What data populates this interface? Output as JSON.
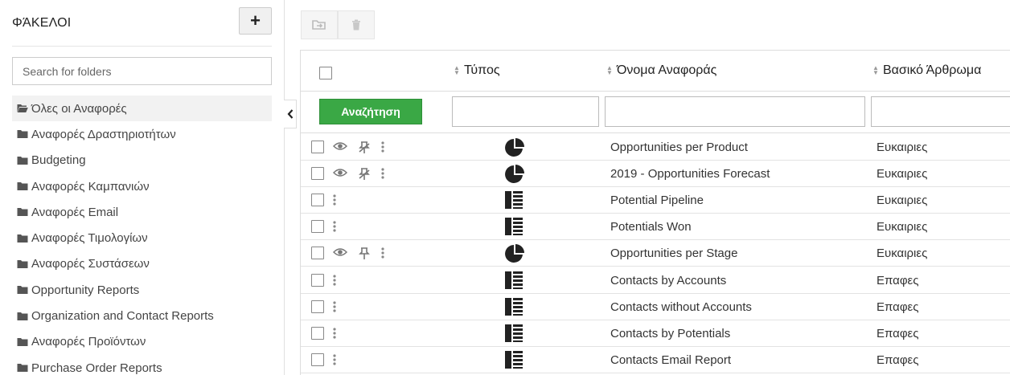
{
  "sidebar": {
    "title": "ΦΆΚΕΛΟΙ",
    "add_label": "+",
    "search_placeholder": "Search for folders",
    "folders": [
      {
        "label": "Όλες οι Αναφορές",
        "active": true
      },
      {
        "label": "Αναφορές Δραστηριοτήτων"
      },
      {
        "label": "Budgeting"
      },
      {
        "label": "Αναφορές Καμπανιών"
      },
      {
        "label": "Αναφορές Email"
      },
      {
        "label": "Αναφορές Τιμολογίων"
      },
      {
        "label": "Αναφορές Συστάσεων"
      },
      {
        "label": "Opportunity Reports"
      },
      {
        "label": "Organization and Contact Reports"
      },
      {
        "label": "Αναφορές Προϊόντων"
      },
      {
        "label": "Purchase Order Reports"
      }
    ]
  },
  "table": {
    "columns": {
      "type": "Τύπος",
      "name": "Όνομα Αναφοράς",
      "module": "Βασικό Άρθρωμα"
    },
    "search_button": "Αναζήτηση",
    "rows": [
      {
        "icon": "pie-chart-icon",
        "name": "Opportunities per Product",
        "module": "Ευκαιριες",
        "actions": [
          "eye-icon",
          "unpin-icon",
          "more-icon"
        ]
      },
      {
        "icon": "pie-chart-icon",
        "name": "2019 - Opportunities Forecast",
        "module": "Ευκαιριες",
        "actions": [
          "eye-icon",
          "unpin-icon",
          "more-icon"
        ]
      },
      {
        "icon": "table-report-icon",
        "name": "Potential Pipeline",
        "module": "Ευκαιριες",
        "actions": [
          "more-icon"
        ]
      },
      {
        "icon": "table-report-icon",
        "name": "Potentials Won",
        "module": "Ευκαιριες",
        "actions": [
          "more-icon"
        ]
      },
      {
        "icon": "pie-chart-icon",
        "name": "Opportunities per Stage",
        "module": "Ευκαιριες",
        "actions": [
          "eye-icon",
          "pin-icon",
          "more-icon"
        ]
      },
      {
        "icon": "table-report-icon",
        "name": "Contacts by Accounts",
        "module": "Επαφες",
        "actions": [
          "more-icon"
        ]
      },
      {
        "icon": "table-report-icon",
        "name": "Contacts without Accounts",
        "module": "Επαφες",
        "actions": [
          "more-icon"
        ]
      },
      {
        "icon": "table-report-icon",
        "name": "Contacts by Potentials",
        "module": "Επαφες",
        "actions": [
          "more-icon"
        ]
      },
      {
        "icon": "table-report-icon",
        "name": "Contacts Email Report",
        "module": "Επαφες",
        "actions": [
          "more-icon"
        ]
      }
    ]
  },
  "colors": {
    "accent_green": "#3aa845",
    "text": "#333333",
    "border": "#dddddd"
  }
}
